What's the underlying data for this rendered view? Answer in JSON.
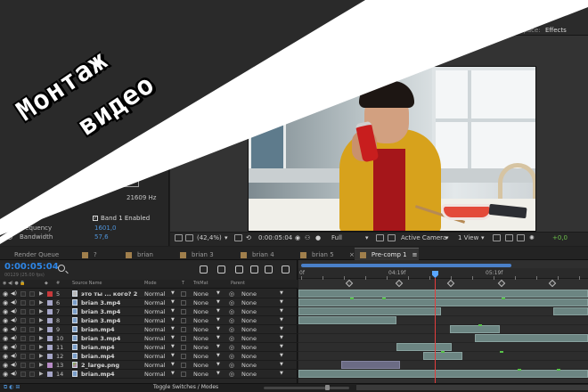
{
  "workspace": {
    "label": "Workspace:",
    "value": "Effects"
  },
  "overlay": {
    "line1": "Монтаж",
    "line2": "видео"
  },
  "effect_panel": {
    "freq_tick": "-",
    "freq_readout": "21609 Hz",
    "band_checkbox": "Band 1 Enabled",
    "band_checked": true,
    "params": [
      {
        "label": "Frequency",
        "value": "1601,0"
      },
      {
        "label": "Bandwidth",
        "value": "57,6"
      }
    ]
  },
  "viewer_bar": {
    "zoom": "(42,4%)",
    "timecode": "0:00:05:04",
    "resolution": "Full",
    "camera": "Active Camera",
    "views": "1 View",
    "exposure": "+0,0"
  },
  "tabs": [
    {
      "label": "Render Queue",
      "color": "#a07f4c"
    },
    {
      "label": "?",
      "color": "#a07f4c"
    },
    {
      "label": "brian",
      "color": "#a07f4c"
    },
    {
      "label": "brian 3",
      "color": "#a07f4c"
    },
    {
      "label": "brian 4",
      "color": "#a07f4c"
    },
    {
      "label": "brian 5",
      "color": "#a07f4c"
    },
    {
      "label": "Pre-comp 1",
      "color": "#a07f4c",
      "active": true
    }
  ],
  "timeline": {
    "timecode": "0:00:05:04",
    "fps": "00129 (25.00 fps)",
    "columns": {
      "num": "#",
      "source": "Source Name",
      "mode": "Mode",
      "t": "T",
      "trkmat": "TrkMat",
      "parent": "Parent"
    },
    "ruler": [
      "0f",
      "04:19f",
      "05:19f"
    ],
    "footer": "Toggle Switches / Modes",
    "layers": [
      {
        "num": "5",
        "name": "это ты ... кого? 2",
        "type": "comp",
        "label_color": "#c8393b",
        "mode": "Normal",
        "trkmat": "None",
        "parent": "None"
      },
      {
        "num": "6",
        "name": "brian 3.mp4",
        "type": "video",
        "label_color": "#a6a6c8",
        "mode": "Normal",
        "trkmat": "None",
        "parent": "None"
      },
      {
        "num": "7",
        "name": "brian 3.mp4",
        "type": "video",
        "label_color": "#a6a6c8",
        "mode": "Normal",
        "trkmat": "None",
        "parent": "None"
      },
      {
        "num": "8",
        "name": "brian 3.mp4",
        "type": "video",
        "label_color": "#a6a6c8",
        "mode": "Normal",
        "trkmat": "None",
        "parent": "None"
      },
      {
        "num": "9",
        "name": "brian.mp4",
        "type": "video",
        "label_color": "#a6a6c8",
        "mode": "Normal",
        "trkmat": "None",
        "parent": "None"
      },
      {
        "num": "10",
        "name": "brian 3.mp4",
        "type": "video",
        "label_color": "#a6a6c8",
        "mode": "Normal",
        "trkmat": "None",
        "parent": "None"
      },
      {
        "num": "11",
        "name": "brian.mp4",
        "type": "video",
        "label_color": "#a6a6c8",
        "mode": "Normal",
        "trkmat": "None",
        "parent": "None"
      },
      {
        "num": "12",
        "name": "brian.mp4",
        "type": "video",
        "label_color": "#a6a6c8",
        "mode": "Normal",
        "trkmat": "None",
        "parent": "None"
      },
      {
        "num": "13",
        "name": "2_large.png",
        "type": "image",
        "label_color": "#b78bc6",
        "mode": "Normal",
        "trkmat": "None",
        "parent": "None"
      },
      {
        "num": "14",
        "name": "brian.mp4",
        "type": "video",
        "label_color": "#a6a6c8",
        "mode": "Normal",
        "trkmat": "None",
        "parent": "None"
      }
    ]
  }
}
